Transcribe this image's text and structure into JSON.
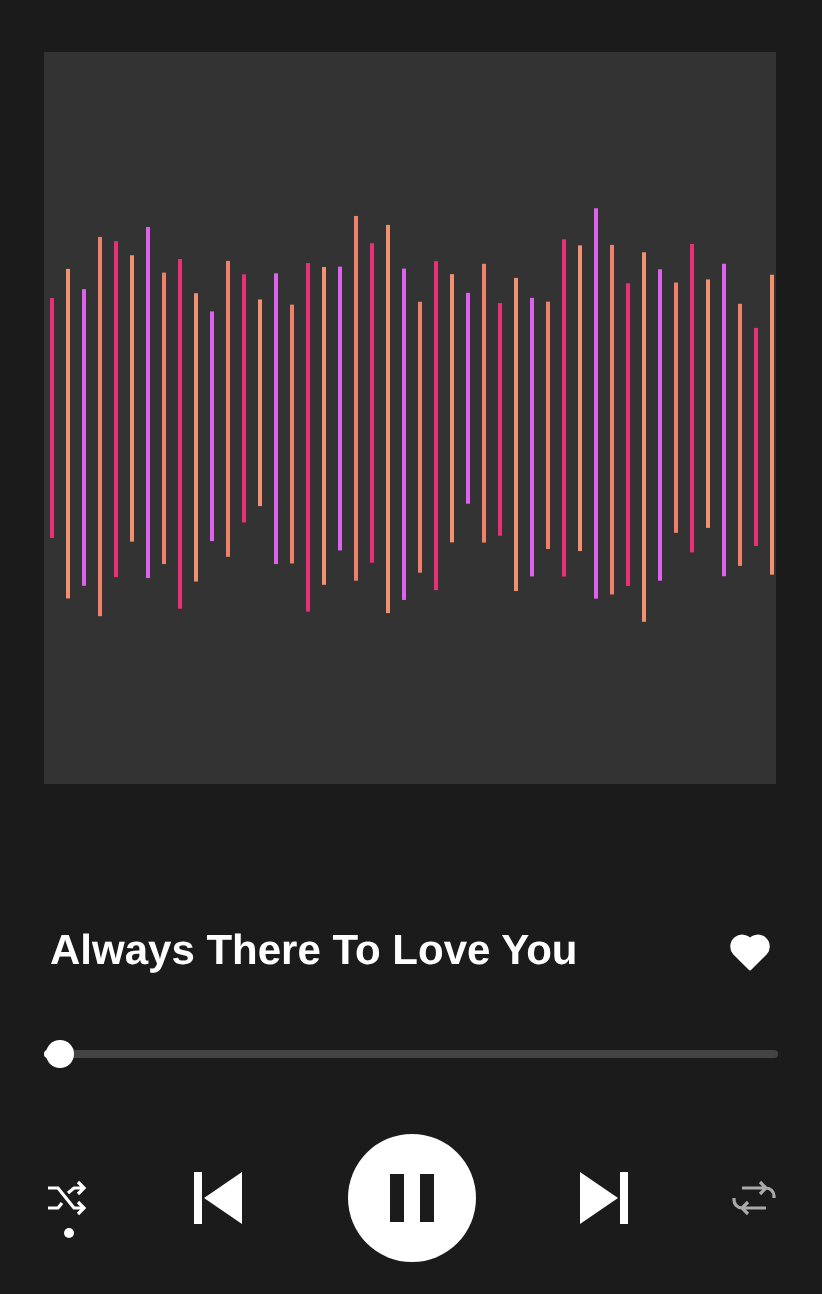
{
  "artwork": {
    "kind": "waveform"
  },
  "track": {
    "title": "Always There To Love You",
    "liked": true
  },
  "progress": {
    "level": 0.02
  },
  "controls": {
    "shuffle": true,
    "playing": true,
    "repeat": false
  }
}
